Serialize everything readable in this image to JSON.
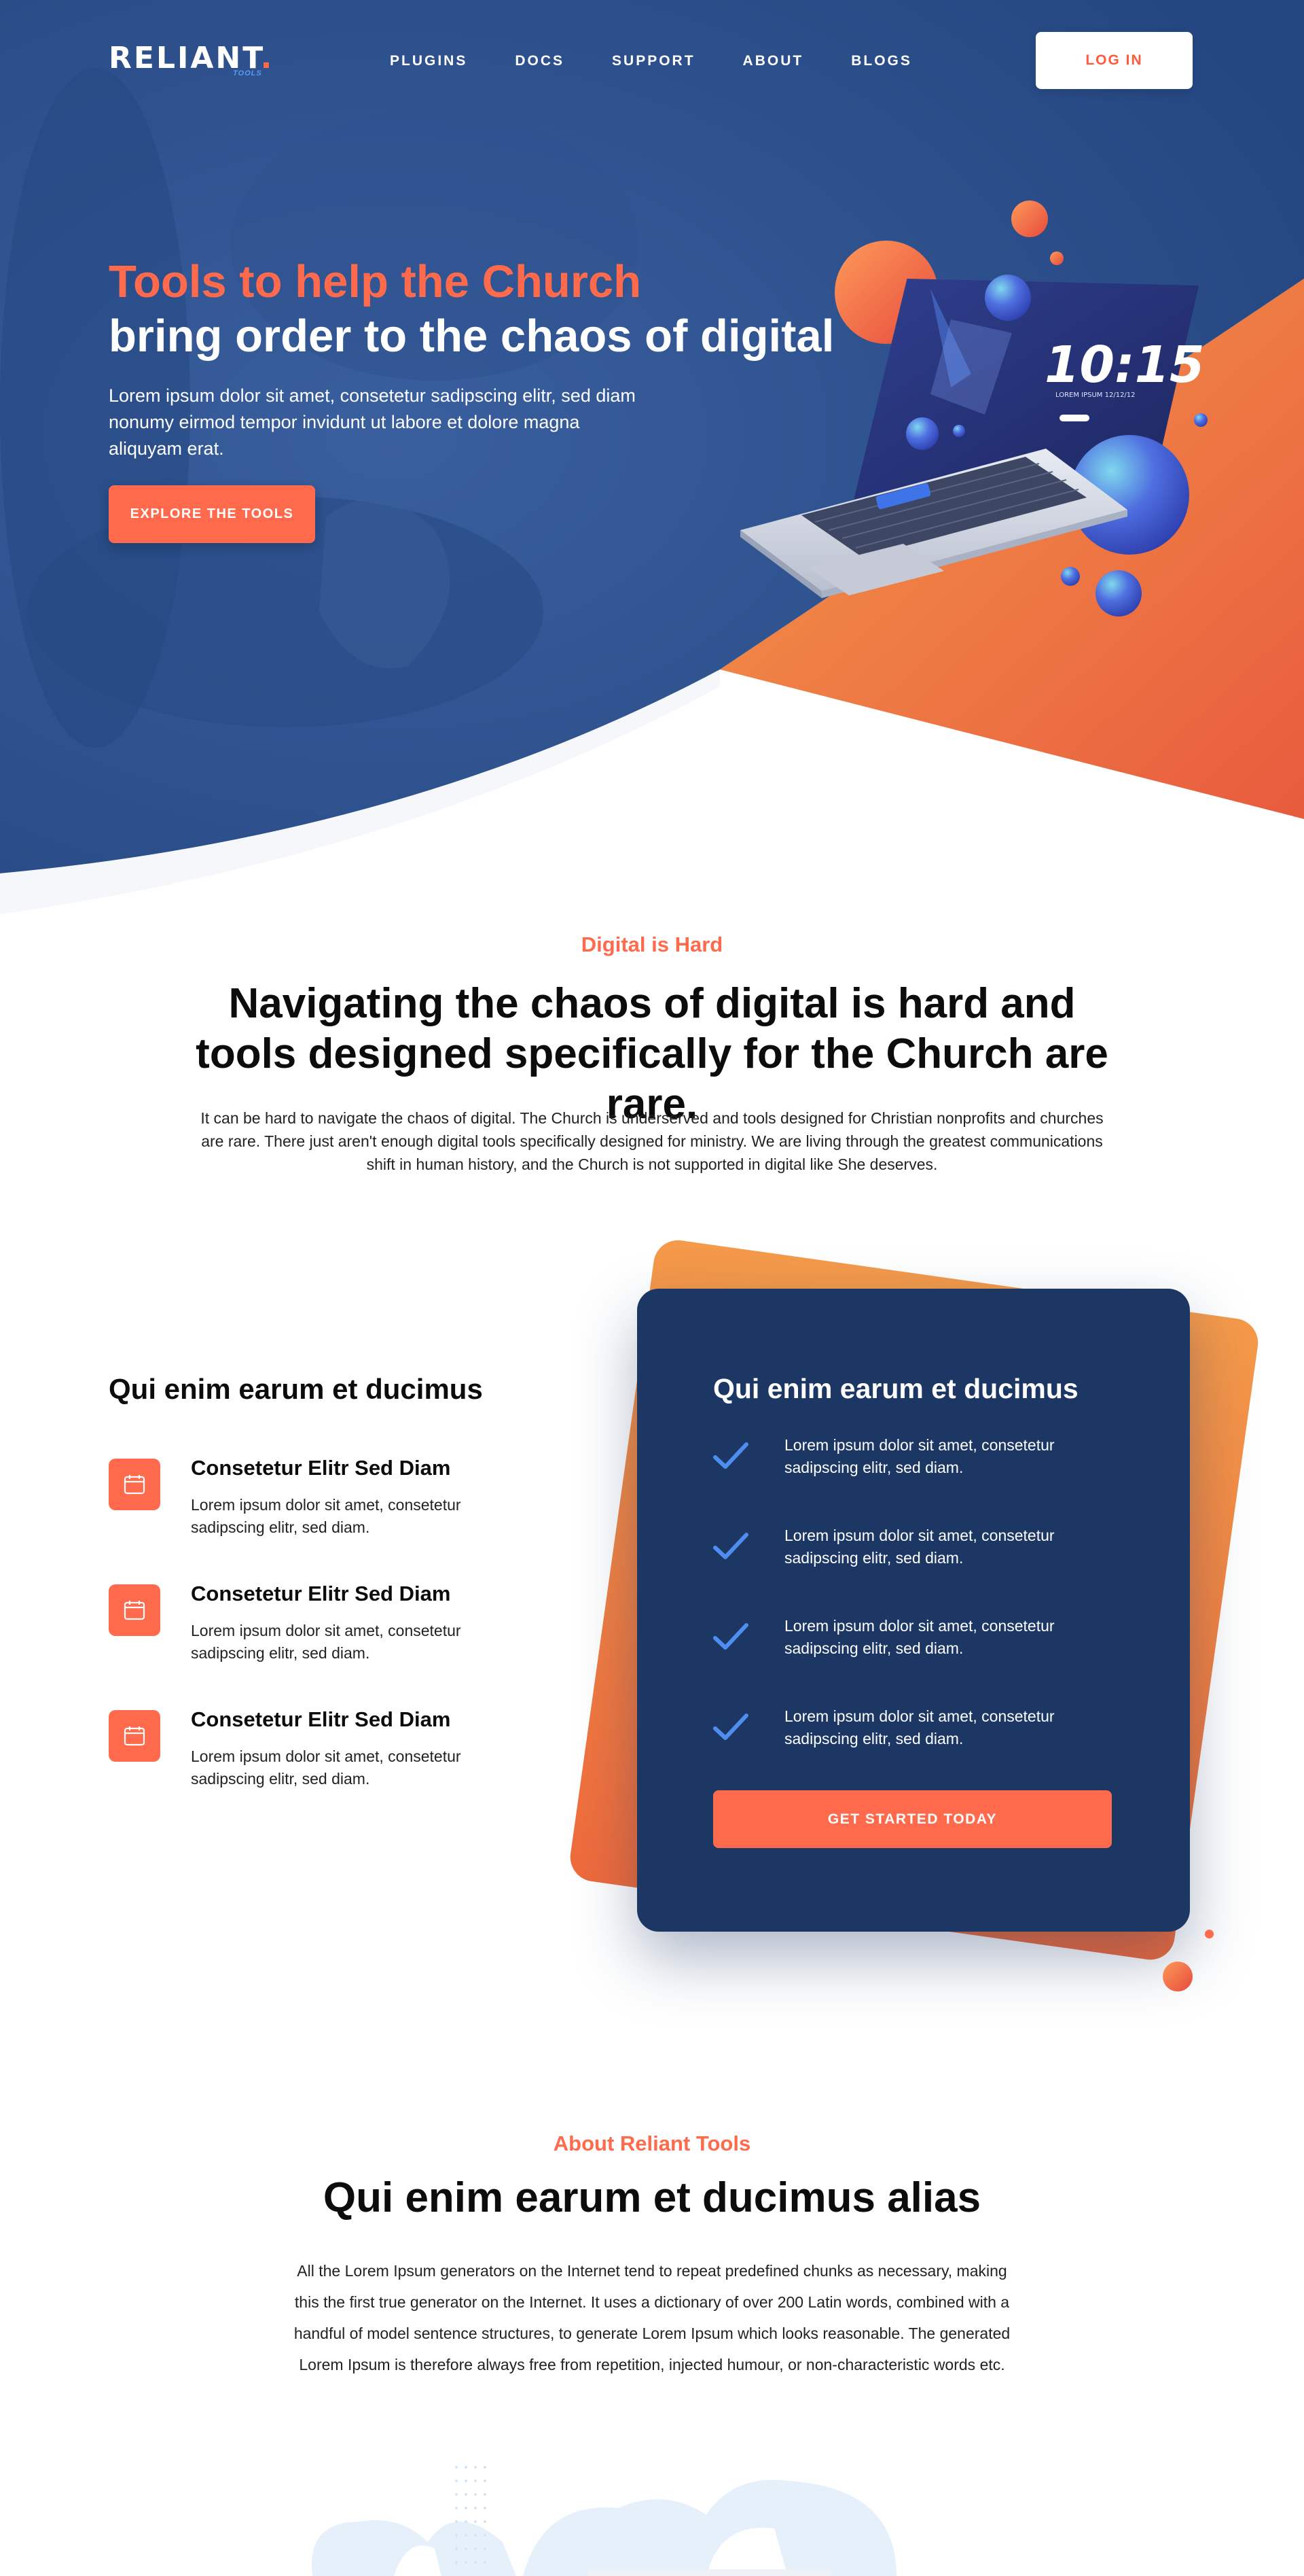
{
  "brand": {
    "name": "RELIANT",
    "dot": ".",
    "sub": "TOOLS"
  },
  "nav": {
    "items": [
      "PLUGINS",
      "DOCS",
      "SUPPORT",
      "ABOUT",
      "BLOGS"
    ],
    "login_label": "LOG IN"
  },
  "hero": {
    "title_line1": "Tools to help the Church",
    "title_line2": "bring order to the chaos of digital",
    "description": "Lorem ipsum dolor sit amet, consetetur sadipscing elitr, sed diam nonumy eirmod tempor invidunt ut labore et dolore magna aliquyam erat.",
    "cta_label": "EXPLORE THE TOOLS",
    "laptop_clock": "10:15",
    "laptop_date": "LOREM IPSUM 12/12/12"
  },
  "intro": {
    "eyebrow": "Digital is Hard",
    "title": "Navigating the chaos of digital is hard and tools designed specifically for the Church are rare.",
    "description": "It can be hard to navigate the chaos of digital. The Church is underserved and tools designed for Christian nonprofits and churches are rare. There just aren't enough digital tools specifically designed for ministry. We are living through the greatest communications shift in human history, and the Church is not supported in digital like She deserves."
  },
  "features": {
    "heading": "Qui enim earum et ducimus",
    "items": [
      {
        "icon": "calendar-icon",
        "title": "Consetetur Elitr Sed Diam",
        "text": "Lorem ipsum dolor sit amet, consetetur sadipscing elitr, sed diam."
      },
      {
        "icon": "calendar-icon",
        "title": "Consetetur Elitr Sed Diam",
        "text": "Lorem ipsum dolor sit amet, consetetur sadipscing elitr, sed diam."
      },
      {
        "icon": "calendar-icon",
        "title": "Consetetur Elitr Sed Diam",
        "text": "Lorem ipsum dolor sit amet, consetetur sadipscing elitr, sed diam."
      }
    ]
  },
  "card": {
    "heading": "Qui enim earum et ducimus",
    "checks": [
      "Lorem ipsum dolor sit amet, consetetur sadipscing elitr, sed diam.",
      "Lorem ipsum dolor sit amet, consetetur sadipscing elitr, sed diam.",
      "Lorem ipsum dolor sit amet, consetetur sadipscing elitr, sed diam.",
      "Lorem ipsum dolor sit amet, consetetur sadipscing elitr, sed diam."
    ],
    "cta_label": "GET STARTED TODAY"
  },
  "about": {
    "eyebrow": "About Reliant Tools",
    "title": "Qui enim earum et ducimus alias",
    "description": "All the Lorem Ipsum generators on the Internet tend to repeat predefined chunks as necessary, making this the first true generator on the Internet. It uses a dictionary of over 200 Latin words, combined with a handful of model sentence structures, to generate Lorem Ipsum which looks reasonable. The generated Lorem Ipsum is therefore always free from repetition, injected humour, or non-characteristic words etc."
  },
  "colors": {
    "navy": "#1c3764",
    "hero_blue": "#2b4f8f",
    "accent": "#ff6a4d",
    "check_blue": "#4f8ef0"
  }
}
